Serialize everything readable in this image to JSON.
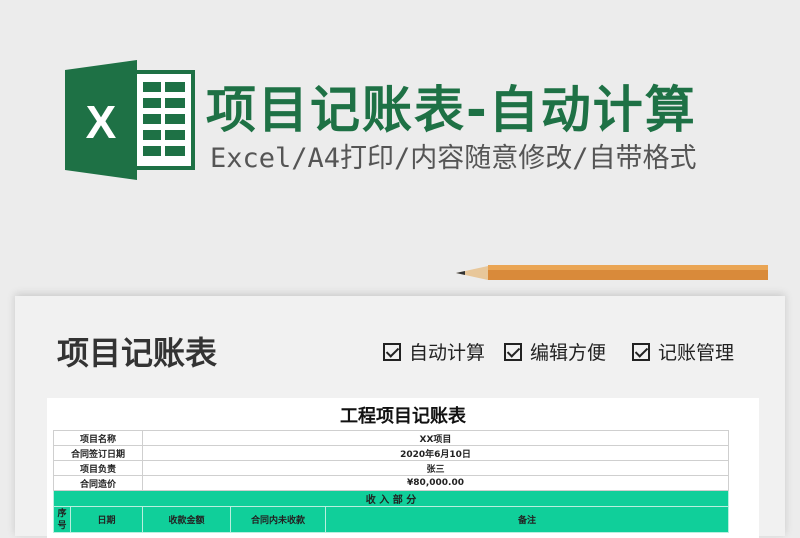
{
  "banner": {
    "title": "项目记账表-自动计算",
    "subtitle": "Excel/A4打印/内容随意修改/自带格式",
    "logo_letter": "X"
  },
  "card": {
    "title": "项目记账表",
    "features": [
      "自动计算",
      "编辑方便",
      "记账管理"
    ]
  },
  "sheet": {
    "title": "工程项目记账表",
    "info": [
      {
        "label": "项目名称",
        "value": "XX项目"
      },
      {
        "label": "合同签订日期",
        "value": "2020年6月10日"
      },
      {
        "label": "项目负责",
        "value": "张三"
      },
      {
        "label": "合同造价",
        "value": "¥80,000.00"
      }
    ],
    "section": "收 入 部 分",
    "columns": [
      "序号",
      "日期",
      "收款金额",
      "合同内未收款",
      "备注"
    ]
  },
  "colors": {
    "brand": "#1e7145",
    "section": "#10cf9a"
  }
}
